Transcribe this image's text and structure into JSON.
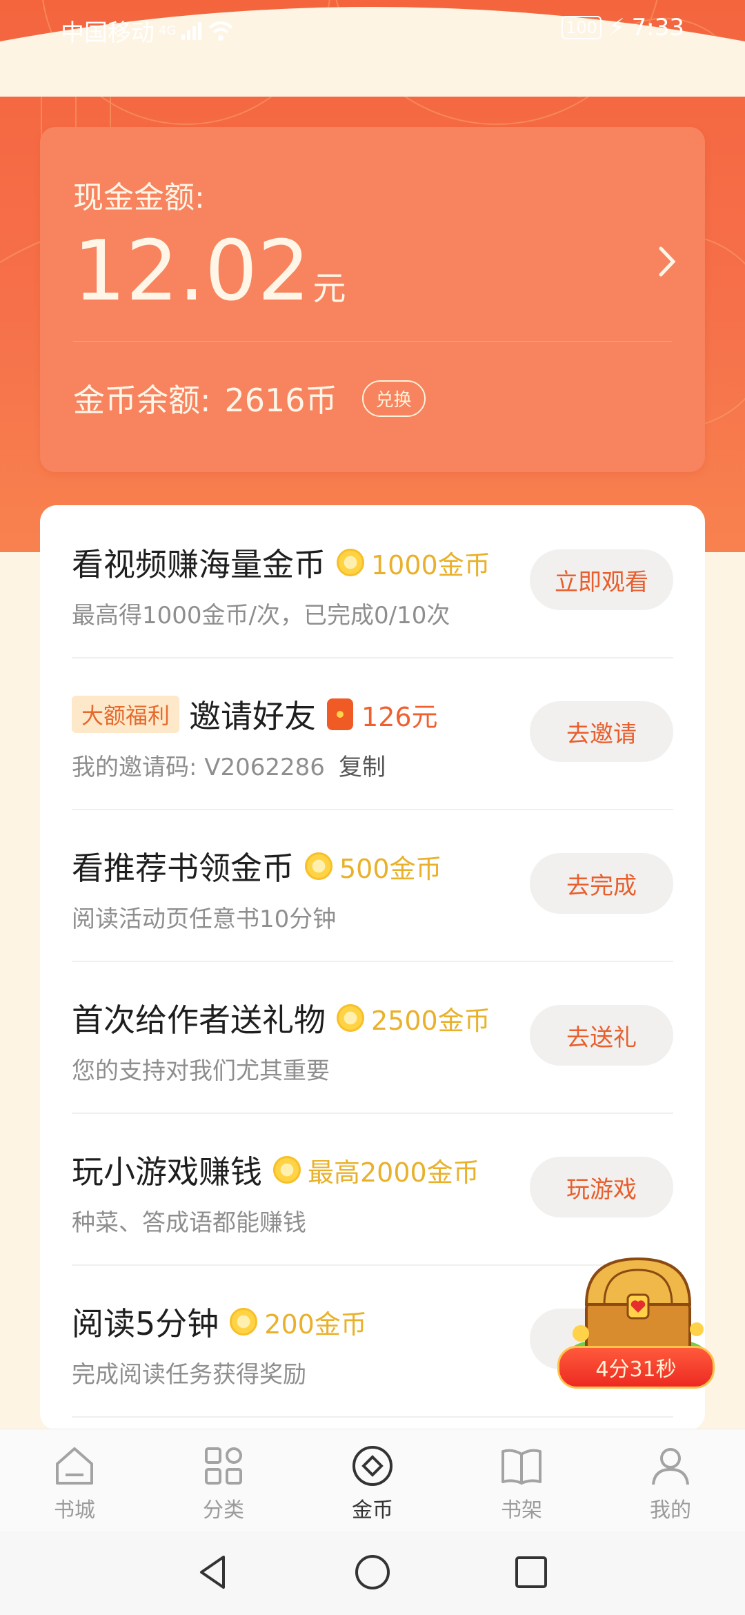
{
  "status_bar": {
    "carrier": "中国移动",
    "network": "4G",
    "battery": "100",
    "time": "7:33"
  },
  "cash_card": {
    "label": "现金金额:",
    "amount": "12.02",
    "unit": "元",
    "coin_label": "金币余额:",
    "coin_amount": "2616币",
    "exchange_label": "兑换"
  },
  "tasks": [
    {
      "title": "看视频赚海量金币",
      "reward": "1000金币",
      "desc": "最高得1000金币/次，已完成0/10次",
      "button": "立即观看"
    },
    {
      "tag": "大额福利",
      "title": "邀请好友",
      "reward": "126元",
      "desc": "我的邀请码: V2062286",
      "desc_link": "复制",
      "button": "去邀请"
    },
    {
      "title": "看推荐书领金币",
      "reward": "500金币",
      "desc": "阅读活动页任意书10分钟",
      "button": "去完成"
    },
    {
      "title": "首次给作者送礼物",
      "reward": "2500金币",
      "desc": "您的支持对我们尤其重要",
      "button": "去送礼"
    },
    {
      "title": "玩小游戏赚钱",
      "reward": "最高2000金币",
      "desc": "种菜、答成语都能赚钱",
      "button": "玩游戏"
    },
    {
      "title": "阅读5分钟",
      "reward": "200金币",
      "desc": "完成阅读任务获得奖励",
      "button": ""
    }
  ],
  "floating_chest": {
    "timer": "4分31秒"
  },
  "bottom_nav": [
    {
      "label": "书城",
      "icon": "home-icon"
    },
    {
      "label": "分类",
      "icon": "grid-icon"
    },
    {
      "label": "金币",
      "icon": "coin-icon",
      "active": true
    },
    {
      "label": "书架",
      "icon": "book-icon"
    },
    {
      "label": "我的",
      "icon": "user-icon"
    }
  ],
  "colors": {
    "header_orange": "#f4653e",
    "card_orange": "#f7845f",
    "accent": "#e85e2c",
    "coin_gold": "#e9b12b"
  }
}
